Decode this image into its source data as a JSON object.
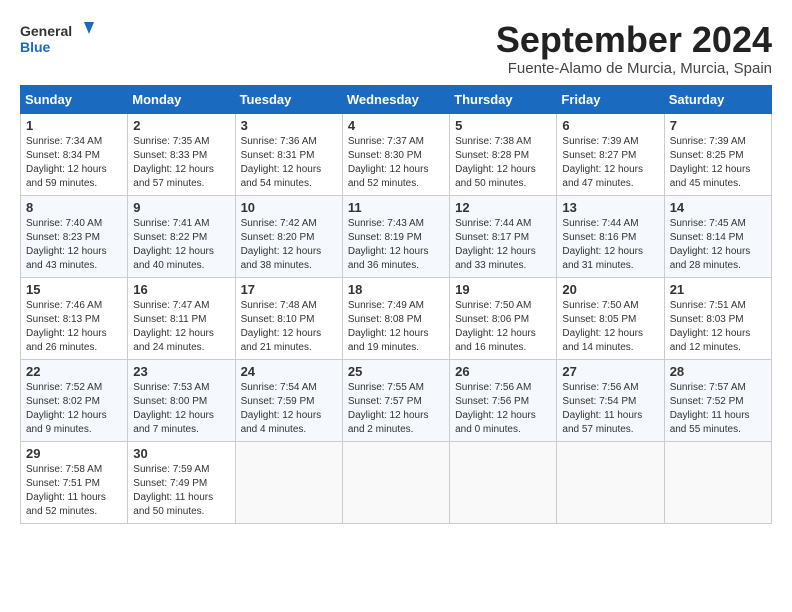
{
  "header": {
    "logo_line1": "General",
    "logo_line2": "Blue",
    "month": "September 2024",
    "location": "Fuente-Alamo de Murcia, Murcia, Spain"
  },
  "weekdays": [
    "Sunday",
    "Monday",
    "Tuesday",
    "Wednesday",
    "Thursday",
    "Friday",
    "Saturday"
  ],
  "weeks": [
    [
      {
        "day": "1",
        "info": "Sunrise: 7:34 AM\nSunset: 8:34 PM\nDaylight: 12 hours\nand 59 minutes."
      },
      {
        "day": "2",
        "info": "Sunrise: 7:35 AM\nSunset: 8:33 PM\nDaylight: 12 hours\nand 57 minutes."
      },
      {
        "day": "3",
        "info": "Sunrise: 7:36 AM\nSunset: 8:31 PM\nDaylight: 12 hours\nand 54 minutes."
      },
      {
        "day": "4",
        "info": "Sunrise: 7:37 AM\nSunset: 8:30 PM\nDaylight: 12 hours\nand 52 minutes."
      },
      {
        "day": "5",
        "info": "Sunrise: 7:38 AM\nSunset: 8:28 PM\nDaylight: 12 hours\nand 50 minutes."
      },
      {
        "day": "6",
        "info": "Sunrise: 7:39 AM\nSunset: 8:27 PM\nDaylight: 12 hours\nand 47 minutes."
      },
      {
        "day": "7",
        "info": "Sunrise: 7:39 AM\nSunset: 8:25 PM\nDaylight: 12 hours\nand 45 minutes."
      }
    ],
    [
      {
        "day": "8",
        "info": "Sunrise: 7:40 AM\nSunset: 8:23 PM\nDaylight: 12 hours\nand 43 minutes."
      },
      {
        "day": "9",
        "info": "Sunrise: 7:41 AM\nSunset: 8:22 PM\nDaylight: 12 hours\nand 40 minutes."
      },
      {
        "day": "10",
        "info": "Sunrise: 7:42 AM\nSunset: 8:20 PM\nDaylight: 12 hours\nand 38 minutes."
      },
      {
        "day": "11",
        "info": "Sunrise: 7:43 AM\nSunset: 8:19 PM\nDaylight: 12 hours\nand 36 minutes."
      },
      {
        "day": "12",
        "info": "Sunrise: 7:44 AM\nSunset: 8:17 PM\nDaylight: 12 hours\nand 33 minutes."
      },
      {
        "day": "13",
        "info": "Sunrise: 7:44 AM\nSunset: 8:16 PM\nDaylight: 12 hours\nand 31 minutes."
      },
      {
        "day": "14",
        "info": "Sunrise: 7:45 AM\nSunset: 8:14 PM\nDaylight: 12 hours\nand 28 minutes."
      }
    ],
    [
      {
        "day": "15",
        "info": "Sunrise: 7:46 AM\nSunset: 8:13 PM\nDaylight: 12 hours\nand 26 minutes."
      },
      {
        "day": "16",
        "info": "Sunrise: 7:47 AM\nSunset: 8:11 PM\nDaylight: 12 hours\nand 24 minutes."
      },
      {
        "day": "17",
        "info": "Sunrise: 7:48 AM\nSunset: 8:10 PM\nDaylight: 12 hours\nand 21 minutes."
      },
      {
        "day": "18",
        "info": "Sunrise: 7:49 AM\nSunset: 8:08 PM\nDaylight: 12 hours\nand 19 minutes."
      },
      {
        "day": "19",
        "info": "Sunrise: 7:50 AM\nSunset: 8:06 PM\nDaylight: 12 hours\nand 16 minutes."
      },
      {
        "day": "20",
        "info": "Sunrise: 7:50 AM\nSunset: 8:05 PM\nDaylight: 12 hours\nand 14 minutes."
      },
      {
        "day": "21",
        "info": "Sunrise: 7:51 AM\nSunset: 8:03 PM\nDaylight: 12 hours\nand 12 minutes."
      }
    ],
    [
      {
        "day": "22",
        "info": "Sunrise: 7:52 AM\nSunset: 8:02 PM\nDaylight: 12 hours\nand 9 minutes."
      },
      {
        "day": "23",
        "info": "Sunrise: 7:53 AM\nSunset: 8:00 PM\nDaylight: 12 hours\nand 7 minutes."
      },
      {
        "day": "24",
        "info": "Sunrise: 7:54 AM\nSunset: 7:59 PM\nDaylight: 12 hours\nand 4 minutes."
      },
      {
        "day": "25",
        "info": "Sunrise: 7:55 AM\nSunset: 7:57 PM\nDaylight: 12 hours\nand 2 minutes."
      },
      {
        "day": "26",
        "info": "Sunrise: 7:56 AM\nSunset: 7:56 PM\nDaylight: 12 hours\nand 0 minutes."
      },
      {
        "day": "27",
        "info": "Sunrise: 7:56 AM\nSunset: 7:54 PM\nDaylight: 11 hours\nand 57 minutes."
      },
      {
        "day": "28",
        "info": "Sunrise: 7:57 AM\nSunset: 7:52 PM\nDaylight: 11 hours\nand 55 minutes."
      }
    ],
    [
      {
        "day": "29",
        "info": "Sunrise: 7:58 AM\nSunset: 7:51 PM\nDaylight: 11 hours\nand 52 minutes."
      },
      {
        "day": "30",
        "info": "Sunrise: 7:59 AM\nSunset: 7:49 PM\nDaylight: 11 hours\nand 50 minutes."
      },
      {
        "day": "",
        "info": ""
      },
      {
        "day": "",
        "info": ""
      },
      {
        "day": "",
        "info": ""
      },
      {
        "day": "",
        "info": ""
      },
      {
        "day": "",
        "info": ""
      }
    ]
  ]
}
